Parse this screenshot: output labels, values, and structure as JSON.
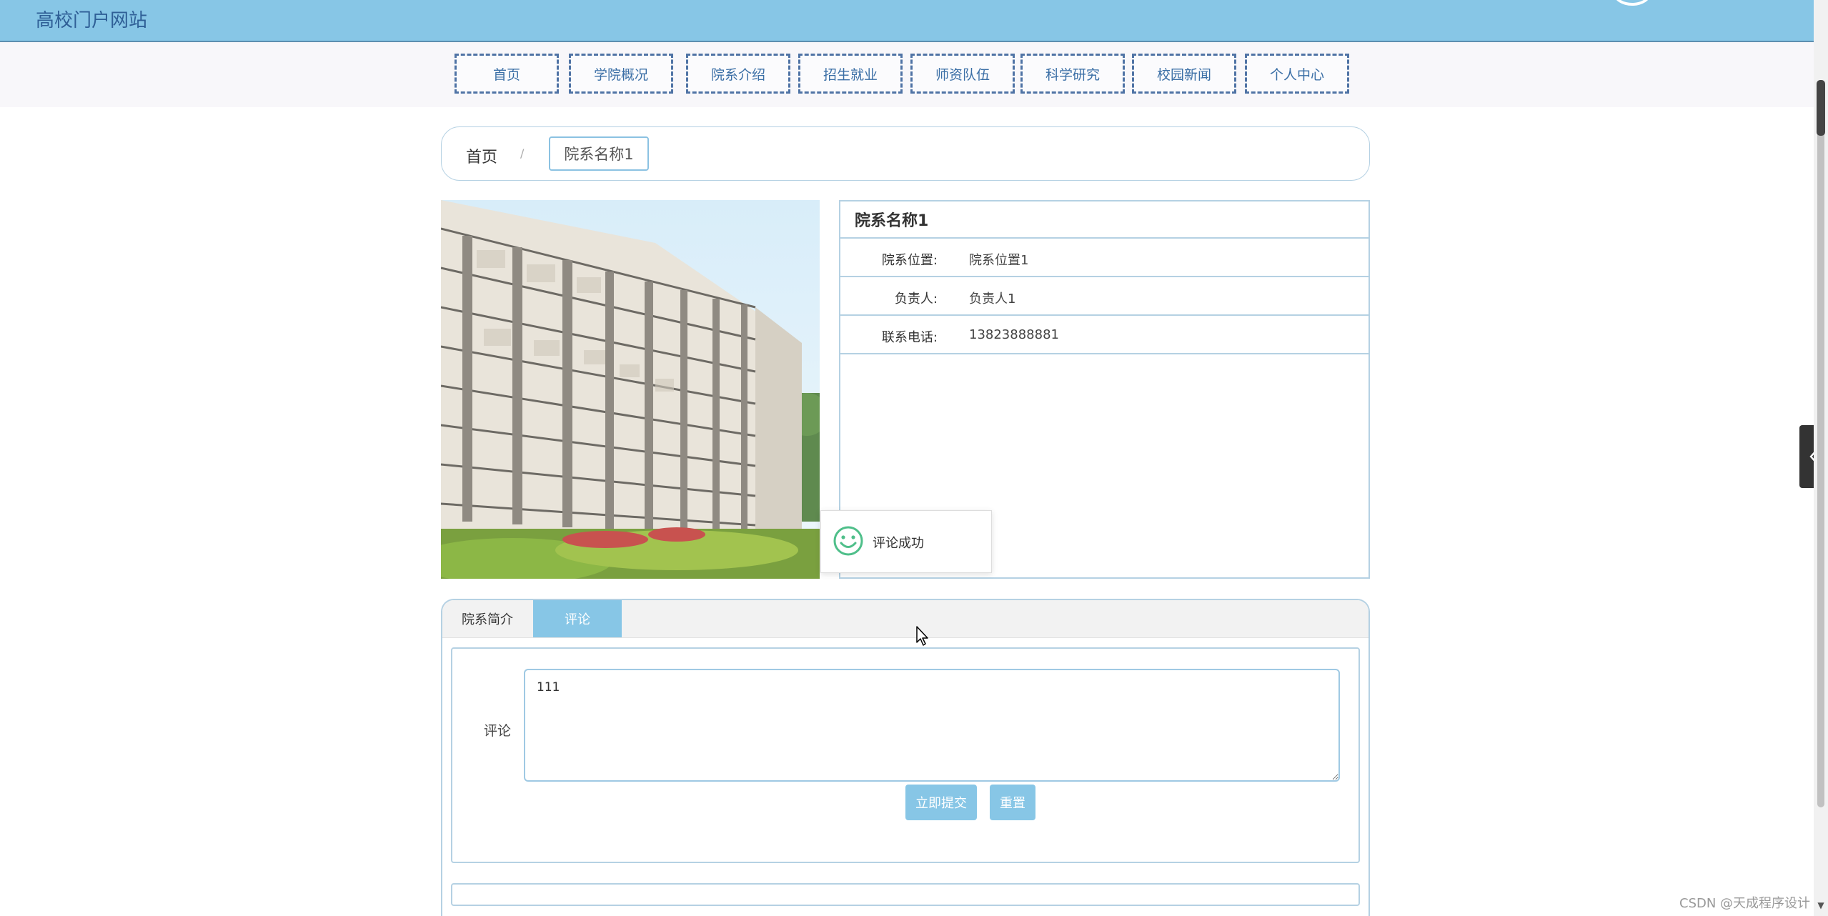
{
  "header": {
    "site_title": "高校门户网站"
  },
  "nav": {
    "items": [
      "首页",
      "学院概况",
      "院系介绍",
      "招生就业",
      "师资队伍",
      "科学研究",
      "校园新闻",
      "个人中心"
    ]
  },
  "breadcrumb": {
    "home": "首页",
    "separator": "/",
    "current": "院系名称1"
  },
  "detail": {
    "title": "院系名称1",
    "rows": [
      {
        "label": "院系位置:",
        "value": "院系位置1"
      },
      {
        "label": "负责人:",
        "value": "负责人1"
      },
      {
        "label": "联系电话:",
        "value": "13823888881"
      }
    ]
  },
  "toast": {
    "text": "评论成功",
    "icon": "smiley-icon"
  },
  "tabs": [
    {
      "label": "院系简介",
      "active": false
    },
    {
      "label": "评论",
      "active": true
    }
  ],
  "comment_form": {
    "label": "评论",
    "value": "111",
    "submit_label": "立即提交",
    "reset_label": "重置"
  },
  "watermark": "CSDN @天成程序设计",
  "colors": {
    "header": "#87c6e6",
    "accent": "#87c6e6",
    "nav_border": "#4f73a5",
    "link": "#3b6fa6"
  }
}
